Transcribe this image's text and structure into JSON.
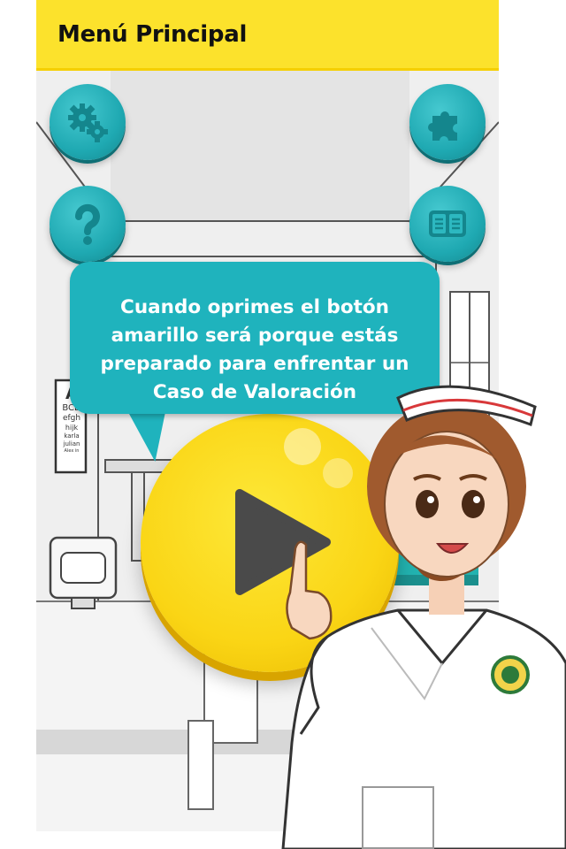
{
  "header": {
    "title": "Menú Principal"
  },
  "buttons": {
    "settings": {
      "icon": "gears-icon"
    },
    "puzzle": {
      "icon": "puzzle-icon"
    },
    "help": {
      "icon": "question-mark-icon"
    },
    "book": {
      "icon": "open-book-icon"
    },
    "play": {
      "icon": "play-icon"
    }
  },
  "bubble": {
    "lines": [
      "Cuando oprimes el botón",
      "amarillo será porque estás",
      "preparado para enfrentar un",
      "Caso de Valoración"
    ]
  },
  "eye_chart": {
    "lines": [
      "A",
      "BCD",
      "efgh",
      "hijk",
      "karla",
      "julian",
      "Alex in"
    ]
  },
  "colors": {
    "header": "#fce22c",
    "accent_teal": "#1fb3bd",
    "play_yellow": "#fad515",
    "play_triangle": "#4a4a4a"
  }
}
